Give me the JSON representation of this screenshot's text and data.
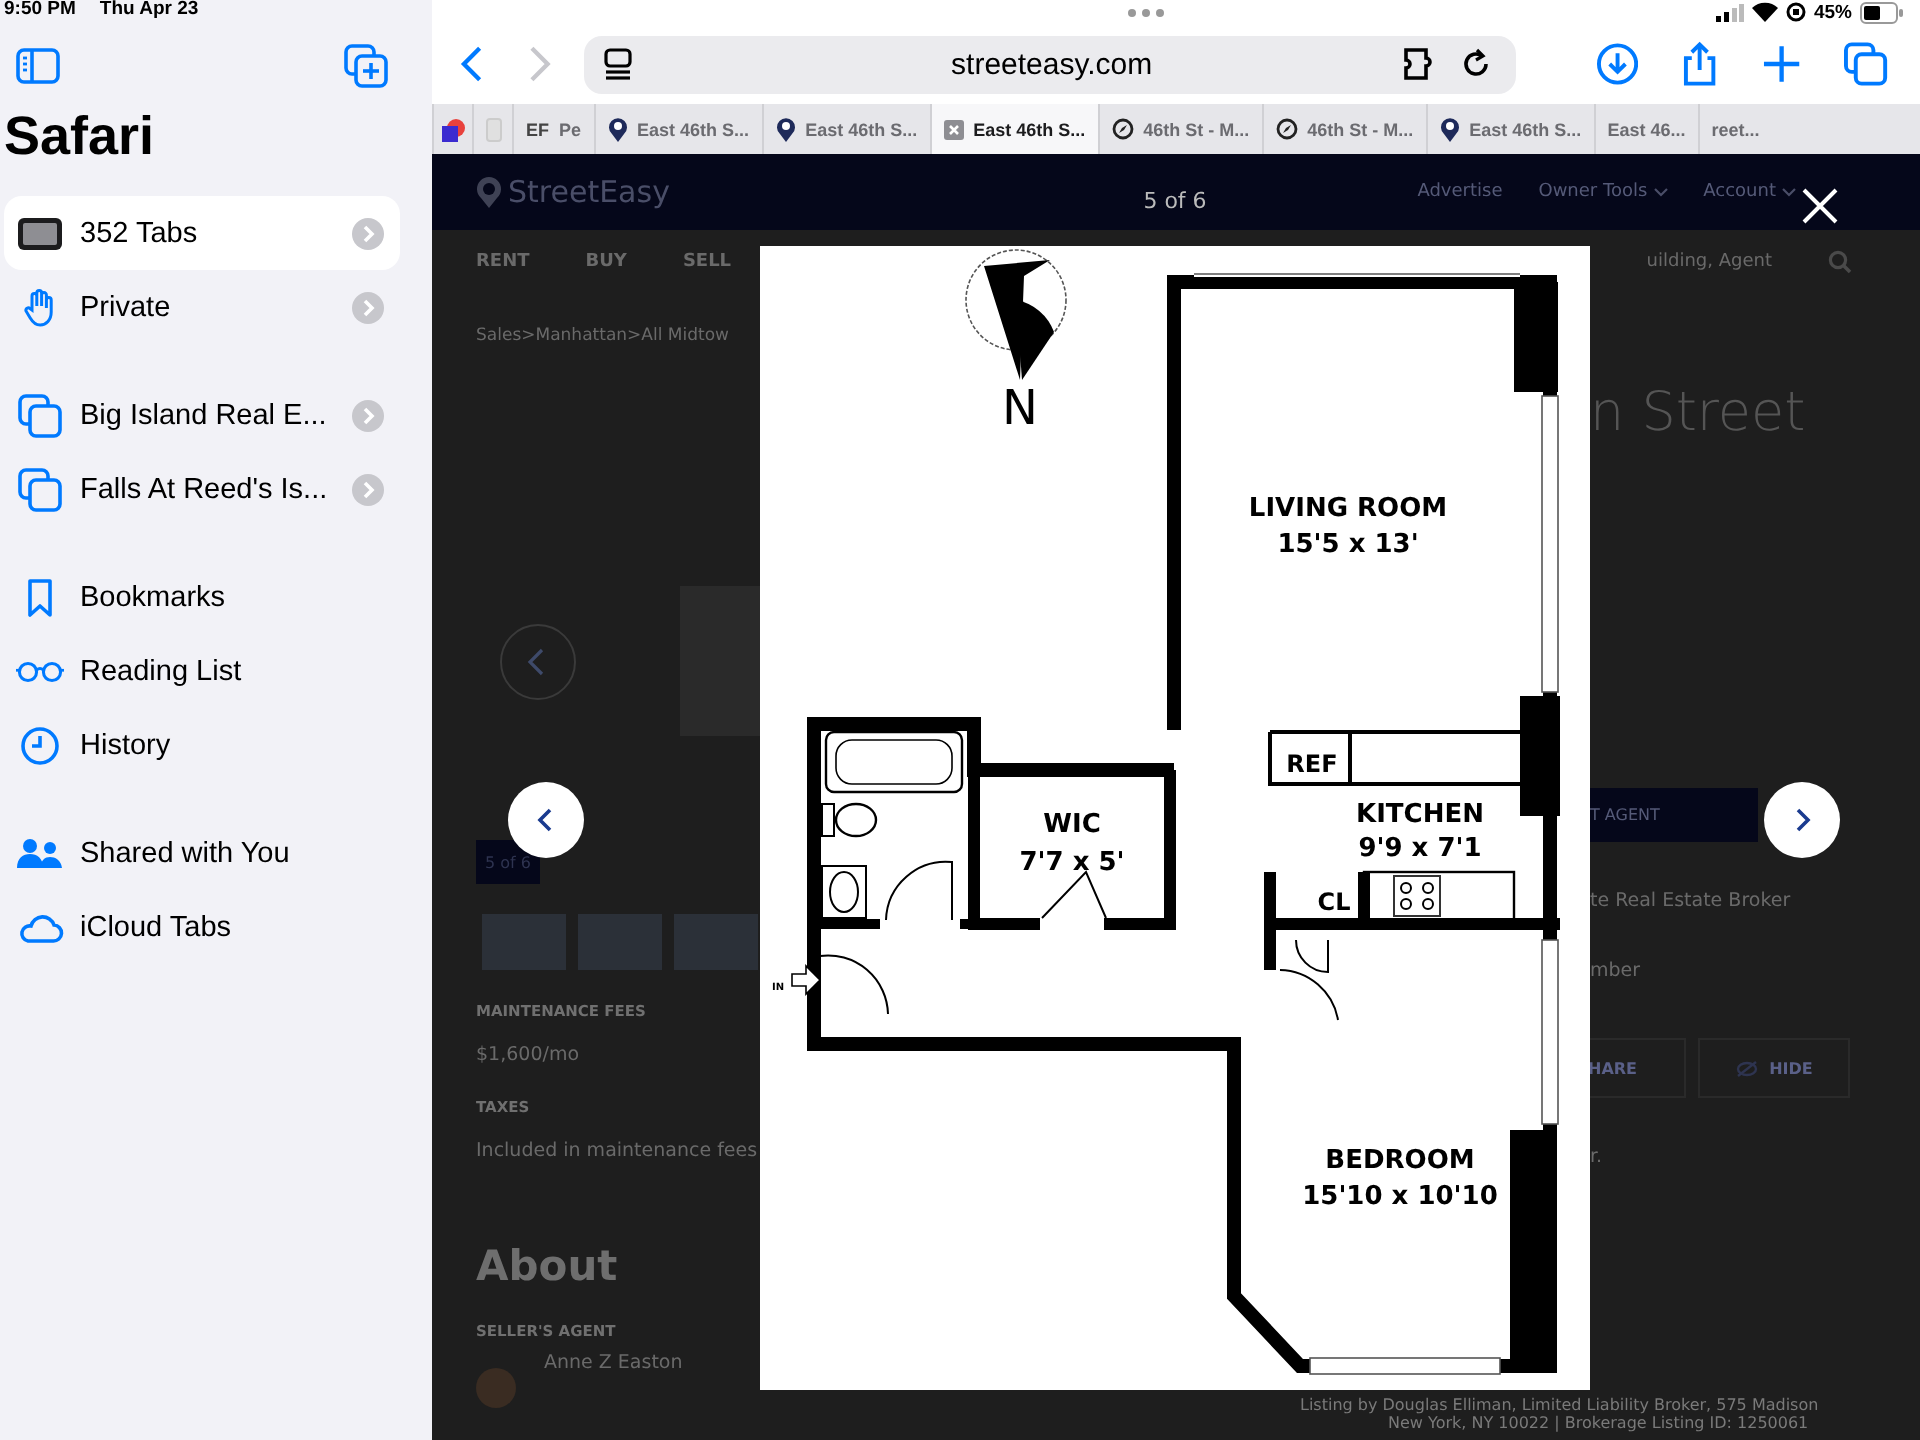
{
  "status_bar": {
    "time": "9:50 PM",
    "date": "Thu Apr 23",
    "battery": "45%"
  },
  "sidebar": {
    "title": "Safari",
    "sections": [
      {
        "items": [
          {
            "label": "352 Tabs",
            "selected": true,
            "chevron": true
          },
          {
            "label": "Private",
            "selected": false,
            "chevron": true
          }
        ]
      },
      {
        "items": [
          {
            "label": "Big Island Real E...",
            "selected": false,
            "chevron": true
          },
          {
            "label": "Falls At Reed's Is...",
            "selected": false,
            "chevron": true
          }
        ]
      },
      {
        "items": [
          {
            "label": "Bookmarks",
            "selected": false,
            "chevron": false
          },
          {
            "label": "Reading List",
            "selected": false,
            "chevron": false
          },
          {
            "label": "History",
            "selected": false,
            "chevron": false
          }
        ]
      },
      {
        "items": [
          {
            "label": "Shared with You",
            "selected": false,
            "chevron": false
          },
          {
            "label": "iCloud Tabs",
            "selected": false,
            "chevron": false
          }
        ]
      }
    ]
  },
  "toolbar": {
    "url": "streeteasy.com"
  },
  "tabs": [
    {
      "selected": false
    },
    {
      "selected": false
    },
    {
      "badge": "EF",
      "label": "Pe",
      "selected": false
    },
    {
      "label": "East 46th S...",
      "selected": false
    },
    {
      "label": "East 46th S...",
      "selected": false
    },
    {
      "label": "East 46th S...",
      "selected": true
    },
    {
      "label": "46th St - M...",
      "selected": false
    },
    {
      "label": "46th St - M...",
      "selected": false
    },
    {
      "label": "East 46th S...",
      "selected": false
    },
    {
      "label": "East 46...",
      "selected": false
    },
    {
      "label": "reet...",
      "selected": false
    }
  ],
  "webpage": {
    "logo": "StreetEasy",
    "header_links": [
      {
        "label": "Advertise",
        "dropdown": false
      },
      {
        "label": "Owner Tools",
        "dropdown": true
      },
      {
        "label": "Account",
        "dropdown": true
      }
    ],
    "nav": [
      "RENT",
      "BUY",
      "SELL"
    ],
    "search_placeholder": "uilding, Agent",
    "breadcrumb": [
      "Sales",
      "Manhattan",
      "All Midtow"
    ],
    "breadcrumb_separator": ">",
    "photo_badge": "5 of 6",
    "left_details": [
      {
        "label": "MAINTENANCE FEES",
        "value": "$1,600/mo"
      },
      {
        "label": "TAXES",
        "value": "Included in maintenance fees"
      }
    ],
    "about_heading": "About",
    "agent_label": "SELLER'S AGENT",
    "agent_name": "Anne Z Easton",
    "title_fragment": "n Street",
    "contact_button": "T AGENT",
    "right_lines": [
      "te Real Estate Broker",
      "mber"
    ],
    "share_button": "HARE",
    "hide_button": "HIDE",
    "note_fragment": "r.",
    "listing_by": [
      "Listing by Douglas Elliman, Limited Liability Broker, 575 Madison",
      "New York, NY 10022 | Brokerage Listing ID: 1250061"
    ]
  },
  "lightbox": {
    "counter": "5 of 6",
    "floor_plan": {
      "compass": "N",
      "rooms": [
        {
          "name": "LIVING ROOM",
          "size": "15'5 x 13'"
        },
        {
          "name": "WIC",
          "size": "7'7 x 5'"
        },
        {
          "name": "KITCHEN",
          "size": "9'9 x 7'1"
        },
        {
          "name": "BEDROOM",
          "size": "15'10 x 10'10"
        }
      ],
      "labels": [
        "REF",
        "CL",
        "IN"
      ]
    }
  }
}
